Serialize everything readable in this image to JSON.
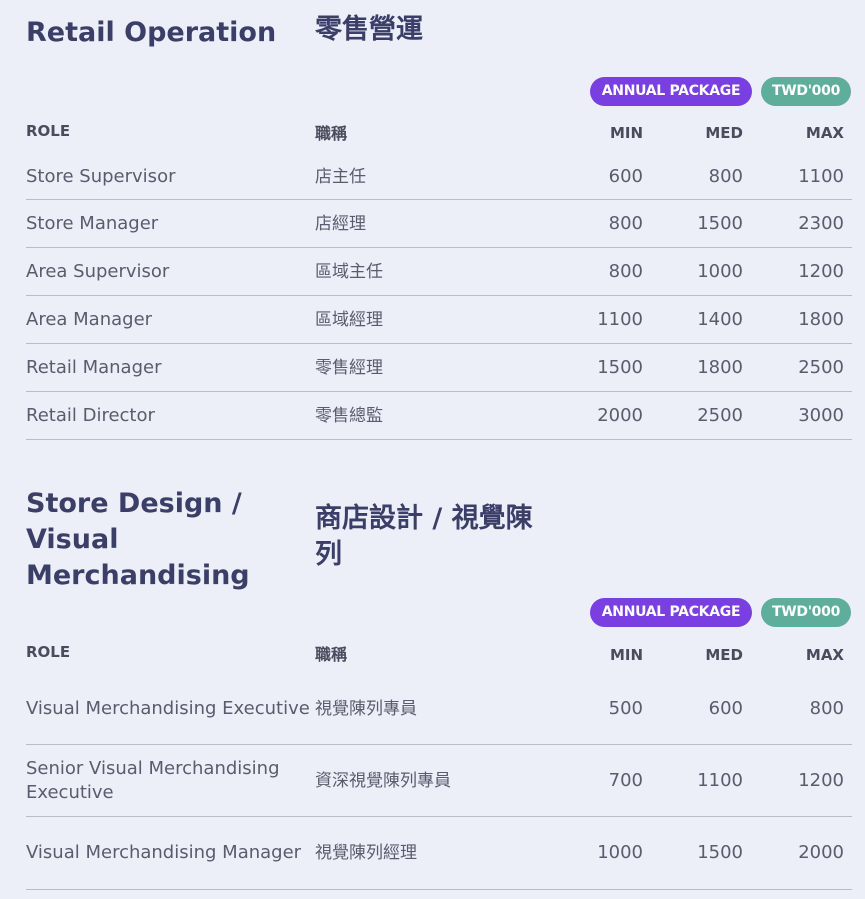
{
  "colors": {
    "background": "#eceef8",
    "title": "#3b3f68",
    "badge_package": "#7a3fe0",
    "badge_currency": "#5fae9c",
    "divider": "#b9bbc8"
  },
  "sections": [
    {
      "title_en": "Retail Operation",
      "title_zh": "零售營運",
      "badge_package": "ANNUAL PACKAGE",
      "badge_currency": "TWD'000",
      "headers": {
        "role": "ROLE",
        "zh": "職稱",
        "min": "MIN",
        "med": "MED",
        "max": "MAX"
      },
      "rows": [
        {
          "role": "Store Supervisor",
          "zh": "店主任",
          "min": "600",
          "med": "800",
          "max": "1100"
        },
        {
          "role": "Store Manager",
          "zh": "店經理",
          "min": "800",
          "med": "1500",
          "max": "2300"
        },
        {
          "role": "Area Supervisor",
          "zh": "區域主任",
          "min": "800",
          "med": "1000",
          "max": "1200"
        },
        {
          "role": "Area Manager",
          "zh": "區域經理",
          "min": "1100",
          "med": "1400",
          "max": "1800"
        },
        {
          "role": "Retail Manager",
          "zh": "零售經理",
          "min": "1500",
          "med": "1800",
          "max": "2500"
        },
        {
          "role": "Retail Director",
          "zh": "零售總監",
          "min": "2000",
          "med": "2500",
          "max": "3000"
        }
      ]
    },
    {
      "title_en": "Store Design / Visual Merchandising",
      "title_zh": "商店設計 / 視覺陳列",
      "badge_package": "ANNUAL PACKAGE",
      "badge_currency": "TWD'000",
      "headers": {
        "role": "ROLE",
        "zh": "職稱",
        "min": "MIN",
        "med": "MED",
        "max": "MAX"
      },
      "rows": [
        {
          "role": "Visual Merchandising Executive",
          "zh": "視覺陳列專員",
          "min": "500",
          "med": "600",
          "max": "800"
        },
        {
          "role": "Senior Visual Merchandising Executive",
          "zh": "資深視覺陳列專員",
          "min": "700",
          "med": "1100",
          "max": "1200"
        },
        {
          "role": "Visual Merchandising Manager",
          "zh": "視覺陳列經理",
          "min": "1000",
          "med": "1500",
          "max": "2000"
        }
      ]
    }
  ]
}
